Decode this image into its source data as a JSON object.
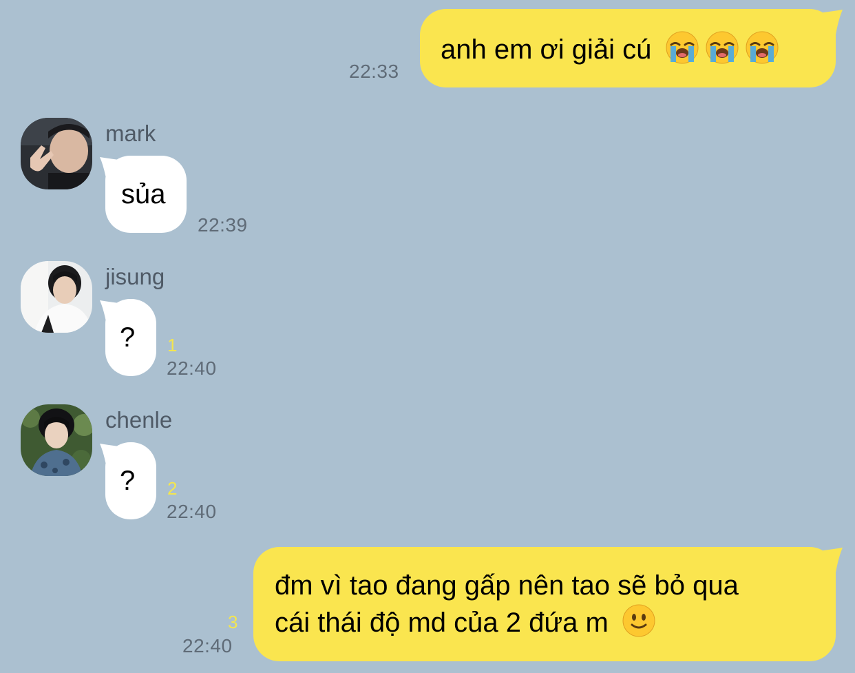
{
  "messages": [
    {
      "side": "outgoing",
      "text": "anh em ơi giải cú",
      "emojis": [
        "loudly-crying-face",
        "loudly-crying-face",
        "loudly-crying-face"
      ],
      "time": "22:33"
    },
    {
      "side": "incoming",
      "sender": "mark",
      "text": "sủa",
      "time": "22:39"
    },
    {
      "side": "incoming",
      "sender": "jisung",
      "text": "?",
      "unread": "1",
      "time": "22:40"
    },
    {
      "side": "incoming",
      "sender": "chenle",
      "text": "?",
      "unread": "2",
      "time": "22:40"
    },
    {
      "side": "outgoing",
      "lines": [
        "đm vì tao đang gấp nên tao sẽ bỏ qua",
        "cái thái độ md của 2 đứa m"
      ],
      "emojis": [
        "slightly-smiling-face"
      ],
      "unread": "3",
      "time": "22:40"
    }
  ],
  "colors": {
    "background": "#abc0d0",
    "outgoing_bubble": "#fae54f",
    "incoming_bubble": "#ffffff",
    "unread_count": "#f4e64e"
  }
}
